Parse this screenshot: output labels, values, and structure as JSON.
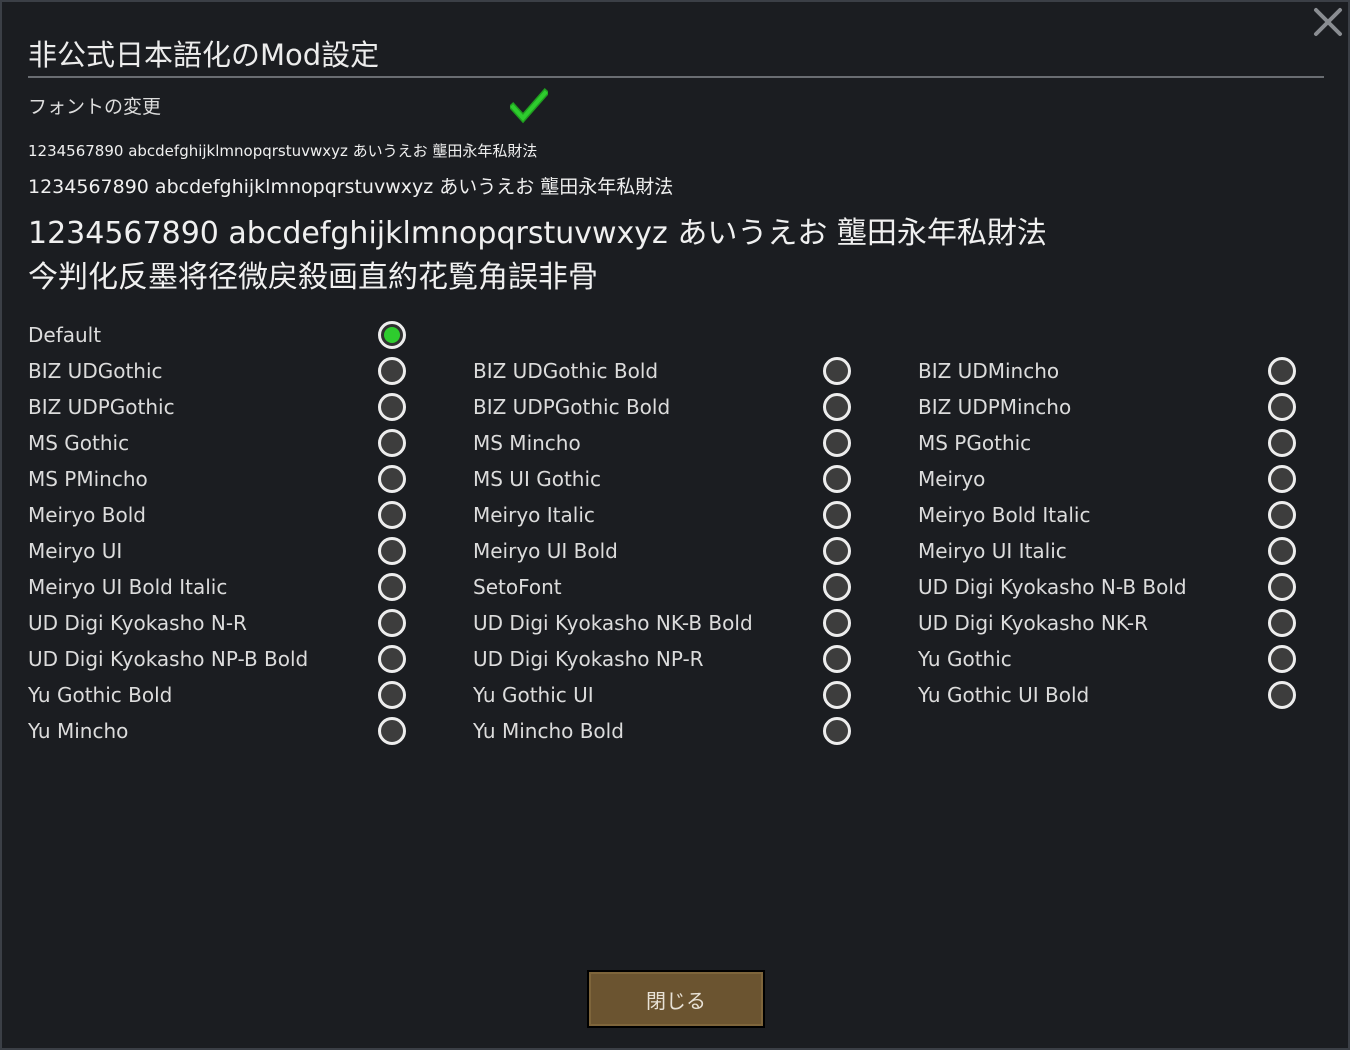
{
  "dialog": {
    "title": "非公式日本語化のMod設定",
    "font_change_label": "フォントの変更",
    "font_change_enabled": true
  },
  "samples": {
    "small": "1234567890 abcdefghijklmnopqrstuvwxyz あいうえお 壟田永年私財法",
    "medium": "1234567890 abcdefghijklmnopqrstuvwxyz あいうえお 壟田永年私財法",
    "large": "1234567890 abcdefghijklmnopqrstuvwxyz あいうえお 壟田永年私財法",
    "kanji": "今判化反墨将径微戻殺画直約花覧角誤非骨"
  },
  "fonts": {
    "default": {
      "label": "Default",
      "selected": true
    },
    "col1": [
      "BIZ UDGothic",
      "BIZ UDPGothic",
      "MS Gothic",
      "MS PMincho",
      "Meiryo Bold",
      "Meiryo UI",
      "Meiryo UI Bold Italic",
      "UD Digi Kyokasho N-R",
      "UD Digi Kyokasho NP-B Bold",
      "Yu Gothic Bold",
      "Yu Mincho"
    ],
    "col2": [
      "BIZ UDGothic Bold",
      "BIZ UDPGothic Bold",
      "MS Mincho",
      "MS UI Gothic",
      "Meiryo Italic",
      "Meiryo UI Bold",
      "SetoFont",
      "UD Digi Kyokasho NK-B Bold",
      "UD Digi Kyokasho NP-R",
      "Yu Gothic UI",
      "Yu Mincho Bold"
    ],
    "col3": [
      "BIZ UDMincho",
      "BIZ UDPMincho",
      "MS PGothic",
      "Meiryo",
      "Meiryo Bold Italic",
      "Meiryo UI Italic",
      "UD Digi Kyokasho N-B Bold",
      "UD Digi Kyokasho NK-R",
      "Yu Gothic",
      "Yu Gothic UI Bold"
    ]
  },
  "footer": {
    "close_label": "閉じる"
  },
  "colors": {
    "accent_green": "#2ecc2e",
    "button_bg": "#6b5430",
    "background": "#1b1d21"
  },
  "icons": {
    "close": "close-icon",
    "check": "checkmark-icon"
  }
}
